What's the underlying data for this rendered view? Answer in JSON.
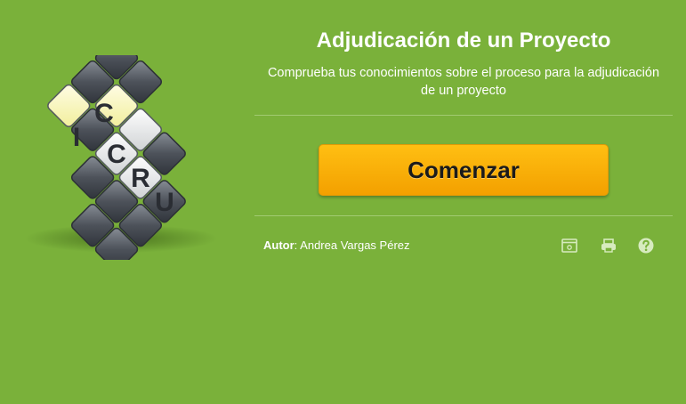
{
  "logo": {
    "letters": [
      "C",
      "I",
      "C",
      "R",
      "U"
    ],
    "name": "cruci-logo"
  },
  "header": {
    "title": "Adjudicación de un Proyecto",
    "subtitle_line1": "Comprueba tus conocimientos sobre el proceso para la adjudicación",
    "subtitle_line2": "de un proyecto"
  },
  "actions": {
    "start_label": "Comenzar"
  },
  "footer": {
    "author_label": "Autor",
    "author_name": ": Andrea Vargas Pérez",
    "icons": [
      "window-icon",
      "print-icon",
      "help-icon"
    ]
  },
  "colors": {
    "background": "#7ab13a",
    "button": "#f5a60b",
    "divider": "#a2ca72"
  }
}
